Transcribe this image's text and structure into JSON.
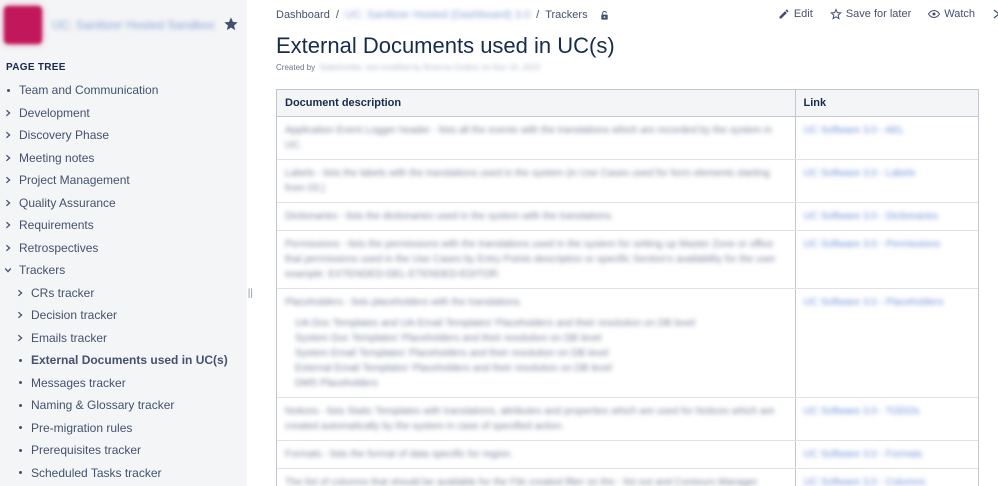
{
  "sidebar": {
    "space_name": "UC: Sanitizer Hosted Sandbox",
    "page_tree_label": "PAGE TREE",
    "items": [
      {
        "label": "Team and Communication",
        "level": 0,
        "marker": "dot"
      },
      {
        "label": "Development",
        "level": 0,
        "marker": "chevron-right"
      },
      {
        "label": "Discovery Phase",
        "level": 0,
        "marker": "chevron-right"
      },
      {
        "label": "Meeting notes",
        "level": 0,
        "marker": "chevron-right"
      },
      {
        "label": "Project Management",
        "level": 0,
        "marker": "chevron-right"
      },
      {
        "label": "Quality Assurance",
        "level": 0,
        "marker": "chevron-right"
      },
      {
        "label": "Requirements",
        "level": 0,
        "marker": "chevron-right"
      },
      {
        "label": "Retrospectives",
        "level": 0,
        "marker": "chevron-right"
      },
      {
        "label": "Trackers",
        "level": 0,
        "marker": "chevron-down"
      },
      {
        "label": "CRs tracker",
        "level": 1,
        "marker": "chevron-right"
      },
      {
        "label": "Decision tracker",
        "level": 1,
        "marker": "chevron-right"
      },
      {
        "label": "Emails tracker",
        "level": 1,
        "marker": "chevron-right"
      },
      {
        "label": "External Documents used in UC(s)",
        "level": 1,
        "marker": "dot",
        "active": true
      },
      {
        "label": "Messages tracker",
        "level": 1,
        "marker": "dot"
      },
      {
        "label": "Naming & Glossary tracker",
        "level": 1,
        "marker": "dot"
      },
      {
        "label": "Pre-migration rules",
        "level": 1,
        "marker": "dot"
      },
      {
        "label": "Prerequisites tracker",
        "level": 1,
        "marker": "dot"
      },
      {
        "label": "Scheduled Tasks tracker",
        "level": 1,
        "marker": "dot"
      }
    ]
  },
  "breadcrumb": {
    "dashboard": "Dashboard",
    "space": "UC: Sanitizer Hosted (Dashboard) 3.0",
    "trackers": "Trackers"
  },
  "actions": {
    "edit": "Edit",
    "save_for_later": "Save for later",
    "watch": "Watch"
  },
  "page": {
    "title": "External Documents used in UC(s)",
    "created_by_label": "Created by",
    "created_by_value": "Stakeholder, last modified by Brianna Godino on Nov 15, 2023"
  },
  "table": {
    "headers": [
      "Document description",
      "Link"
    ],
    "rows": [
      {
        "desc": "Application Event Logger header - lists all the events with the translations which are recorded by the system in UC.",
        "link": "UC Software 3.0 - AEL"
      },
      {
        "desc": "Labels - lists the labels with the translations used in the system (in Use Cases used for form elements starting from 03.)",
        "link": "UC Software 3.0 - Labels"
      },
      {
        "desc": "Dictionaries - lists the dictionaries used in the system with the translations.",
        "link": "UC Software 3.0 - Dictionaries"
      },
      {
        "desc": "Permissions - lists the permissions with the translations used in the system for setting up Master Zone or office that permissions used in the Use Cases by Entry Points description or specific Section's availability for the user example: EXTENDED-DEL-ETENDED-EDITOR.",
        "link": "UC Software 3.0 - Permissions"
      },
      {
        "desc": "Placeholders - lists placeholders with the translations.",
        "link": "UC Software 3.0 - Placeholders",
        "bullets": [
          "UA-Doc Templates and UA-Email Templates' Placeholders and their resolution on DB level",
          "System Doc Templates' Placeholders and their resolution on DB level",
          "System Email Templates' Placeholders and their resolution on DB level",
          "External Email Templates' Placeholders and their resolution on DB level",
          "DMS Placeholders"
        ]
      },
      {
        "desc": "Notices - lists Static Templates with translations, attributes and properties which are used for Notices which are created automatically by the system in case of specified action.",
        "link": "UC Software 3.0 - TODOs"
      },
      {
        "desc": "Formats - lists the format of data specific for region.",
        "link": "UC Software 3.0 - Formats"
      },
      {
        "desc": "The list of columns that should be available for the File created filter on the - list out and Contours Manager",
        "link": "UC Software 3.0 - Columns"
      }
    ]
  },
  "colors": {
    "sidebar_bg": "#f4f5f7",
    "text": "#172b4d",
    "link": "#0052cc",
    "space_logo": "#c2185b"
  }
}
